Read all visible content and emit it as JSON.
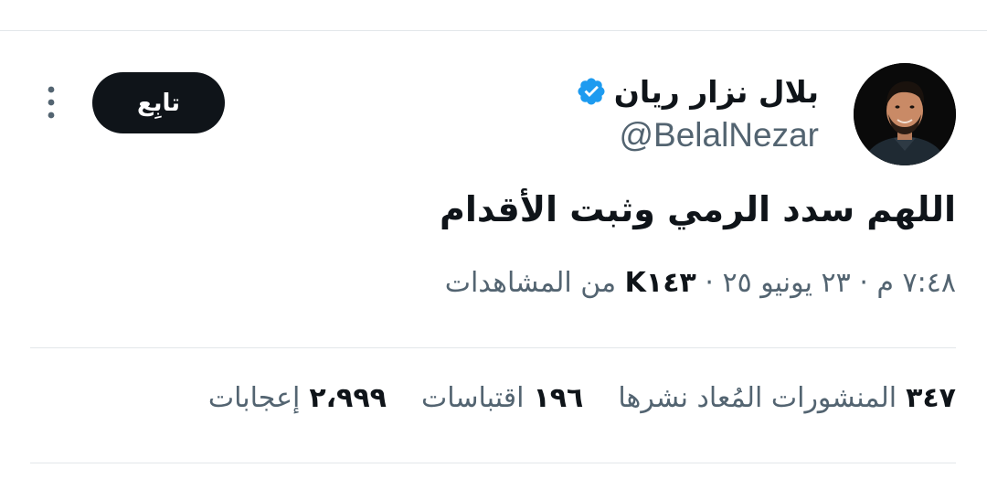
{
  "author": {
    "display_name": "بلال نزار ريان",
    "handle": "@BelalNezar",
    "verified_badge_color": "#1d9bf0"
  },
  "actions": {
    "follow_label": "تابِع",
    "more_icon": "more-vertical-icon"
  },
  "tweet": {
    "text": "اللهم سدد الرمي وثبت الأقدام",
    "time": "٧:٤٨ م",
    "separator": "·",
    "date": "٢٣ يونيو ٢٥",
    "views_count": "K١٤٣",
    "views_label": "من المشاهدات"
  },
  "stats": [
    {
      "count": "٣٤٧",
      "label": "المنشورات المُعاد نشرها"
    },
    {
      "count": "١٩٦",
      "label": "اقتباسات"
    },
    {
      "count": "٢،٩٩٩",
      "label": "إعجابات"
    }
  ],
  "colors": {
    "text_primary": "#0f1419",
    "text_secondary": "#536471",
    "divider": "#e3e7ea",
    "follow_button_bg": "#0f1419"
  }
}
